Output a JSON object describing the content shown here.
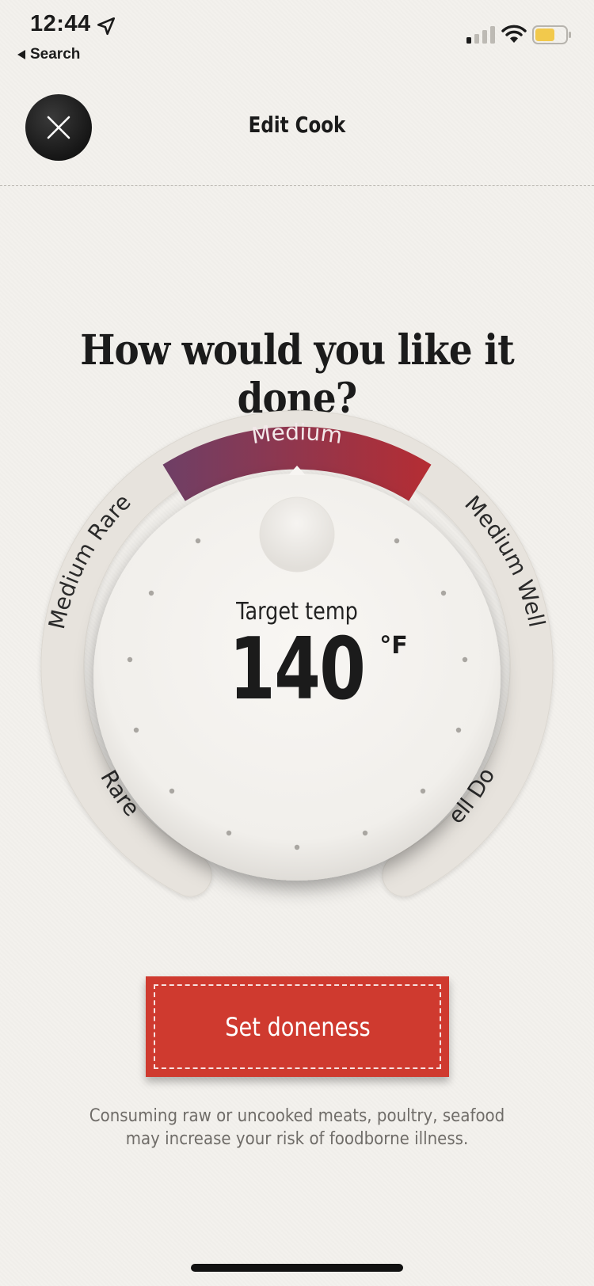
{
  "status_bar": {
    "time": "12:44",
    "back_label": "Search",
    "battery_color": "#f2c94c"
  },
  "header": {
    "title": "Edit Cook"
  },
  "question": "How would you like it done?",
  "dial": {
    "options": [
      "Rare",
      "Medium Rare",
      "Medium",
      "Medium Well",
      "Well Done"
    ],
    "selected": "Medium",
    "target_label": "Target temp",
    "temperature": "140",
    "unit": "°F",
    "selected_color_start": "#6e3f66",
    "selected_color_end": "#b52d33"
  },
  "set_button_label": "Set doneness",
  "disclaimer": "Consuming raw or uncooked meats, poultry, seafood may increase your risk of foodborne illness."
}
